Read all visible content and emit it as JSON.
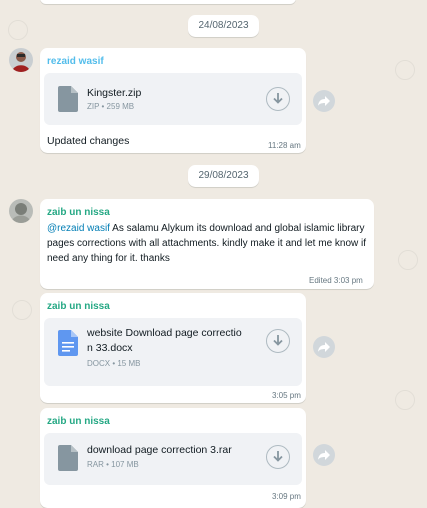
{
  "dates": {
    "first": "24/08/2023",
    "second": "29/08/2023"
  },
  "msg1": {
    "sender": "rezaid wasif",
    "file_name": "Kingster.zip",
    "file_meta": "ZIP • 259 MB",
    "caption": "Updated changes",
    "time": "11:28 am"
  },
  "msg2": {
    "sender": "zaib un nissa",
    "mention": "@rezaid wasif",
    "text": " As salamu Alykum its download and global islamic library pages corrections with all attachments. kindly make it and let me know if need any thing for it. thanks",
    "time": "Edited 3:03 pm"
  },
  "msg3": {
    "sender": "zaib un nissa",
    "file_name_line1": "website Download page correctio",
    "file_name_line2": "n 33.docx",
    "file_meta": "DOCX • 15 MB",
    "time": "3:05 pm"
  },
  "msg4": {
    "sender": "zaib un nissa",
    "file_name": "download page correction 3.rar",
    "file_meta": "RAR • 107 MB",
    "time": "3:09 pm"
  },
  "colors": {
    "background": "#efeae2",
    "bubble": "#ffffff",
    "file_card": "#f0f2f5",
    "sender_teal": "#53bdeb",
    "sender_green": "#25a884",
    "docx_blue": "#5f97f0"
  }
}
